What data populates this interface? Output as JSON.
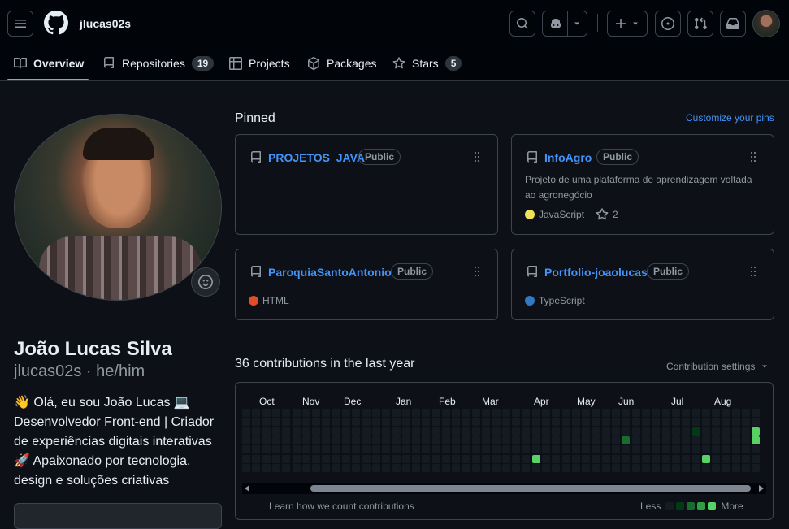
{
  "header": {
    "username": "jlucas02s",
    "icons": [
      "menu-icon",
      "github-logo-icon",
      "search-icon",
      "copilot-icon",
      "chevron-down-icon",
      "plus-icon",
      "issues-icon",
      "pull-requests-icon",
      "inbox-icon"
    ]
  },
  "tabs": [
    {
      "label": "Overview",
      "icon": "book-icon"
    },
    {
      "label": "Repositories",
      "icon": "repo-icon",
      "count": "19"
    },
    {
      "label": "Projects",
      "icon": "table-icon"
    },
    {
      "label": "Packages",
      "icon": "package-icon"
    },
    {
      "label": "Stars",
      "icon": "star-icon",
      "count": "5"
    }
  ],
  "profile": {
    "name": "João Lucas Silva",
    "username_pronouns": "jlucas02s · he/him",
    "bio_lines": [
      "👋 Olá, eu sou João Lucas 💻",
      "Desenvolvedor Front-end | Criador",
      "de experiências digitais interativas",
      "🚀 Apaixonado por tecnologia,",
      "design e soluções criativas"
    ]
  },
  "pinned": {
    "title": "Pinned",
    "customize_link": "Customize your pins",
    "repos": [
      {
        "name": "PROJETOS_JAVA",
        "visibility": "Public",
        "description": "",
        "language": "",
        "language_color": "",
        "stars": ""
      },
      {
        "name": "InfoAgro",
        "visibility": "Public",
        "description": "Projeto de uma plataforma de aprendizagem voltada ao agronegócio",
        "language": "JavaScript",
        "language_color": "#f1e05a",
        "stars": "2"
      },
      {
        "name": "ParoquiaSantoAntonio",
        "visibility": "Public",
        "description": "",
        "language": "HTML",
        "language_color": "#e34c26",
        "stars": ""
      },
      {
        "name": "Portfolio-joaolucas",
        "visibility": "Public",
        "description": "",
        "language": "TypeScript",
        "language_color": "#3178c6",
        "stars": ""
      }
    ]
  },
  "contributions": {
    "title": "36 contributions in the last year",
    "settings_label": "Contribution settings",
    "months": [
      "Oct",
      "Nov",
      "Dec",
      "Jan",
      "Feb",
      "Mar",
      "Apr",
      "May",
      "Jun",
      "Jul",
      "Aug"
    ],
    "learn_link": "Learn how we count contributions",
    "legend_less": "Less",
    "legend_more": "More",
    "legend_colors": [
      "#151b23",
      "#033a16",
      "#196c2e",
      "#2ea043",
      "#56d364"
    ],
    "active_cells": [
      {
        "week": 38,
        "day": 3,
        "level": 2
      },
      {
        "week": 45,
        "day": 2,
        "level": 1
      },
      {
        "week": 29,
        "day": 5,
        "level": 4
      },
      {
        "week": 46,
        "day": 5,
        "level": 4
      },
      {
        "week": 51,
        "day": 2,
        "level": 4
      },
      {
        "week": 51,
        "day": 3,
        "level": 4
      }
    ]
  }
}
